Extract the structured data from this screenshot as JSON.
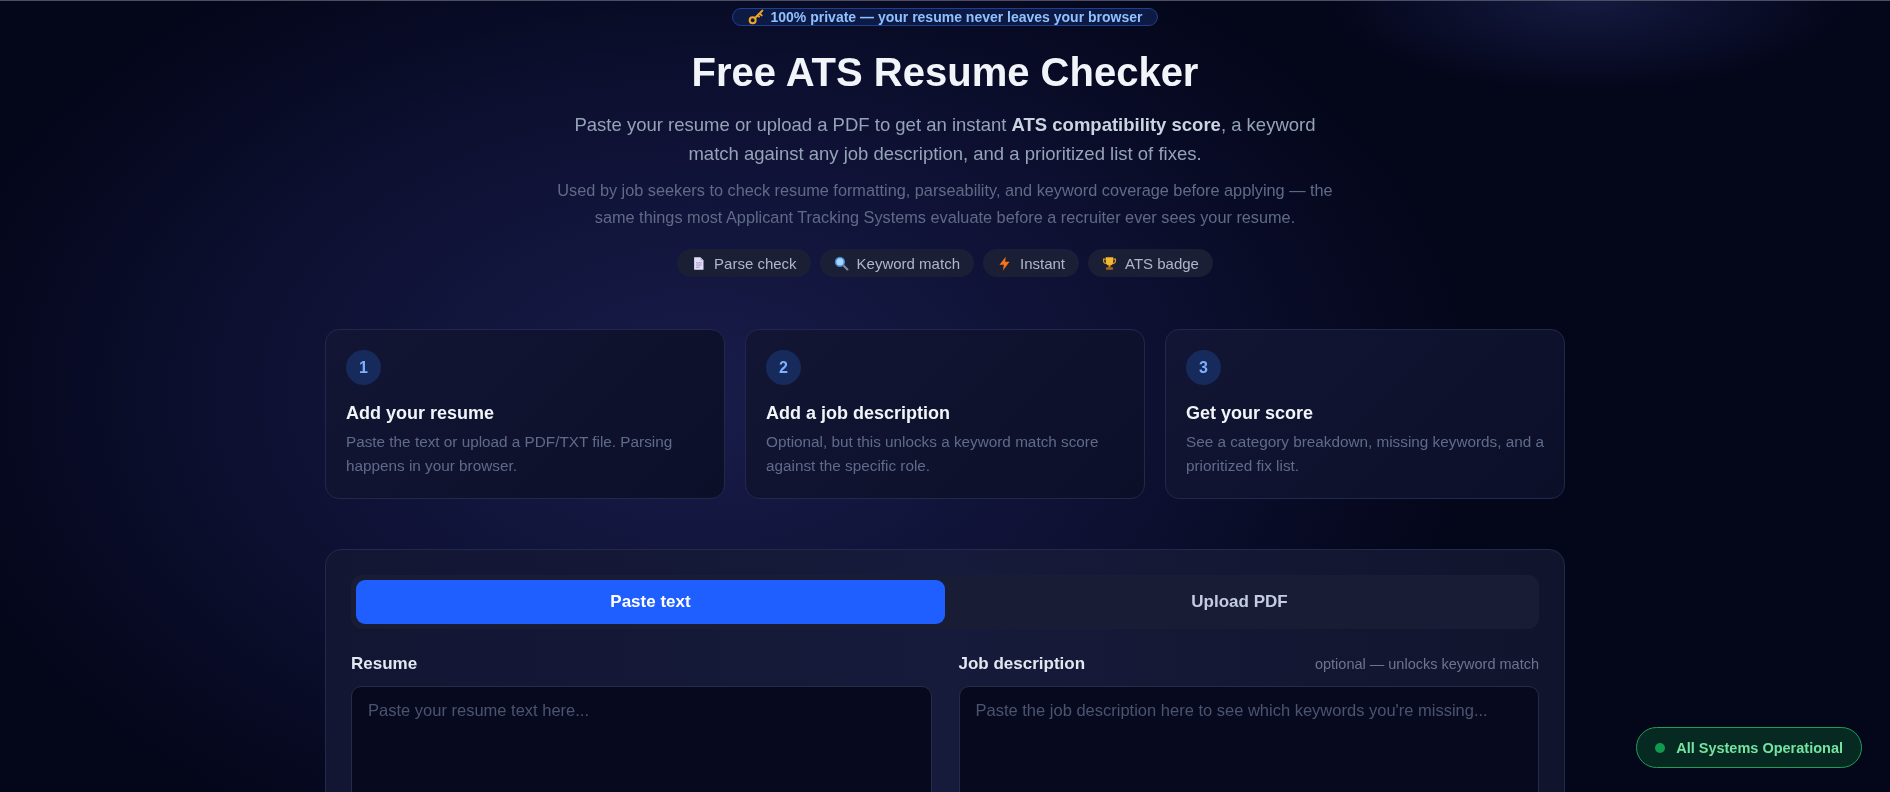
{
  "privacy_badge": {
    "text": "100% private — your resume never leaves your browser"
  },
  "hero": {
    "title": "Free ATS Resume Checker",
    "subtitle": "Paste your resume or upload a PDF to get an instant **ATS compatibility score**, a keyword match against any job description, and a prioritized list of fixes.",
    "description": "Used by job seekers to check resume formatting, parseability, and keyword coverage before applying — the same things most Applicant Tracking Systems evaluate before a recruiter ever sees your resume."
  },
  "feature_chips": [
    {
      "label": "Parse check"
    },
    {
      "label": "Keyword match"
    },
    {
      "label": "Instant"
    },
    {
      "label": "ATS badge"
    }
  ],
  "steps": [
    {
      "number": "1",
      "title": "Add your resume",
      "description": "Paste the text or upload a PDF/TXT file. Parsing happens in your browser."
    },
    {
      "number": "2",
      "title": "Add a job description",
      "description": "Optional, but this unlocks a keyword match score against the specific role."
    },
    {
      "number": "3",
      "title": "Get your score",
      "description": "See a category breakdown, missing keywords, and a prioritized fix list."
    }
  ],
  "input_panel": {
    "tabs": [
      {
        "label": "Paste text",
        "selected": true
      },
      {
        "label": "Upload PDF",
        "selected": false
      }
    ],
    "fields": [
      {
        "label": "Resume",
        "placeholder": "Paste your resume text here..."
      },
      {
        "label": "Job description",
        "hint": "optional — unlocks keyword match",
        "placeholder": "Paste the job description here to see which keywords you're missing..."
      }
    ]
  },
  "status_badge": {
    "text": "All Systems Operational"
  }
}
